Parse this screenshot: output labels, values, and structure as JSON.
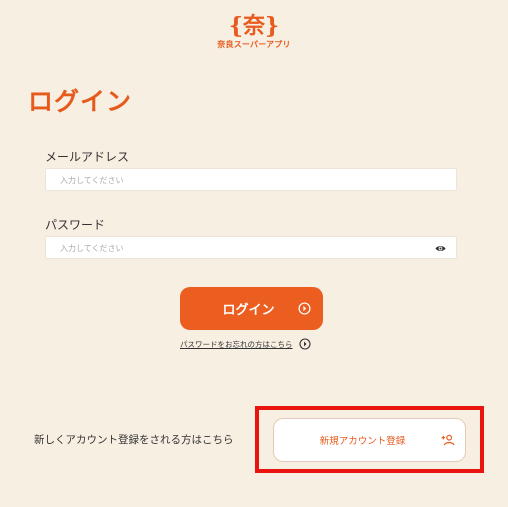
{
  "brand": {
    "mark": "{奈}",
    "name": "奈良スーパーアプリ"
  },
  "page": {
    "title": "ログイン"
  },
  "form": {
    "email_label": "メールアドレス",
    "email_placeholder": "入力してください",
    "password_label": "パスワード",
    "password_placeholder": "入力してください",
    "login_label": "ログイン",
    "forgot_label": "パスワードをお忘れの方はこちら"
  },
  "signup": {
    "prompt": "新しくアカウント登録をされる方はこちら",
    "button_label": "新規アカウント登録"
  },
  "colors": {
    "accent": "#ec5d20",
    "background": "#f7efe2",
    "highlight": "#e8140f"
  },
  "icons": {
    "password_toggle": "eye-icon",
    "login_arrow": "circle-arrow-right-icon",
    "forgot_arrow": "circle-arrow-right-icon",
    "signup_icon": "add-user-icon"
  }
}
